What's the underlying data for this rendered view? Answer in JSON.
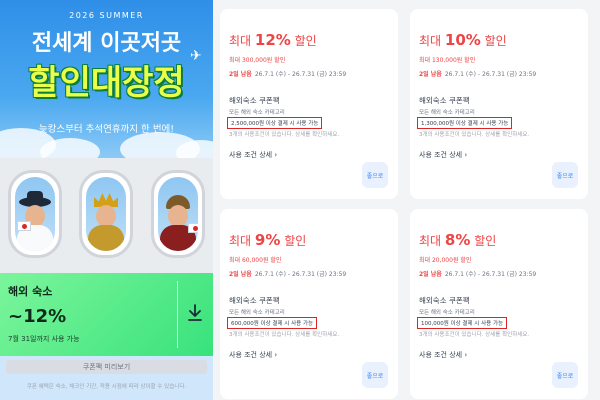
{
  "banner": {
    "year": "2026 SUMMER",
    "title_line1": "전세계 이곳저곳",
    "title_line2": "할인대장정",
    "subtitle": "늦캉스부터 추석연휴까지 한 번에!",
    "plane_icon": "airplane-icon"
  },
  "promo": {
    "category": "해외 숙소",
    "discount": "~12%",
    "period": "7월 31일까지 사용 가능",
    "download_icon": "download-icon"
  },
  "preview_button": "쿠폰팩 미리보기",
  "footnote": "쿠폰 혜택은 숙소, 체크인 기간, 적용 시점에 따라 상이할 수 있습니다.",
  "colors": {
    "accent_red": "#ef4444",
    "highlight_box": "#dc2626",
    "button_blue": "#3b82f6",
    "promo_green": "#38e27c"
  },
  "coupons": [
    {
      "title_prefix": "최대 ",
      "percent": "12%",
      "title_suffix": " 할인",
      "max": "최대 300,000원 할인",
      "days_left": "2일 남음",
      "date_range": "26.7.1 (수) - 26.7.31 (금) 23:59",
      "name": "해외숙소 쿠폰팩",
      "category": "모든 해외 숙소 카테고리",
      "condition": "2,500,000원 이상 결제 시 사용 가능",
      "note": "3개의 사용조건이 있습니다. 상세를 확인하세요.",
      "detail_link": "사용 조건 상세",
      "button": "좋으로"
    },
    {
      "title_prefix": "최대 ",
      "percent": "10%",
      "title_suffix": " 할인",
      "max": "최대 130,000원 할인",
      "days_left": "2일 남음",
      "date_range": "26.7.1 (수) - 26.7.31 (금) 23:59",
      "name": "해외숙소 쿠폰팩",
      "category": "모든 해외 숙소 카테고리",
      "condition": "1,300,000원 이상 결제 시 사용 가능",
      "note": "3개의 사용조건이 있습니다. 상세를 확인하세요.",
      "detail_link": "사용 조건 상세",
      "button": "좋으로"
    },
    {
      "title_prefix": "최대 ",
      "percent": "9%",
      "title_suffix": " 할인",
      "max": "최대 60,000원 할인",
      "days_left": "2일 남음",
      "date_range": "26.7.1 (수) - 26.7.31 (금) 23:59",
      "name": "해외숙소 쿠폰팩",
      "category": "모든 해외 숙소 카테고리",
      "condition": "600,000원 이상 결제 시 사용 가능",
      "note": "3개의 사용조건이 있습니다. 상세를 확인하세요.",
      "detail_link": "사용 조건 상세",
      "button": "좋으로"
    },
    {
      "title_prefix": "최대 ",
      "percent": "8%",
      "title_suffix": " 할인",
      "max": "최대 20,000원 할인",
      "days_left": "2일 남음",
      "date_range": "26.7.1 (수) - 26.7.31 (금) 23:59",
      "name": "해외숙소 쿠폰팩",
      "category": "모든 해외 숙소 카테고리",
      "condition": "100,000원 이상 결제 시 사용 가능",
      "note": "3개의 사용조건이 있습니다. 상세를 확인하세요.",
      "detail_link": "사용 조건 상세",
      "button": "좋으로"
    }
  ]
}
